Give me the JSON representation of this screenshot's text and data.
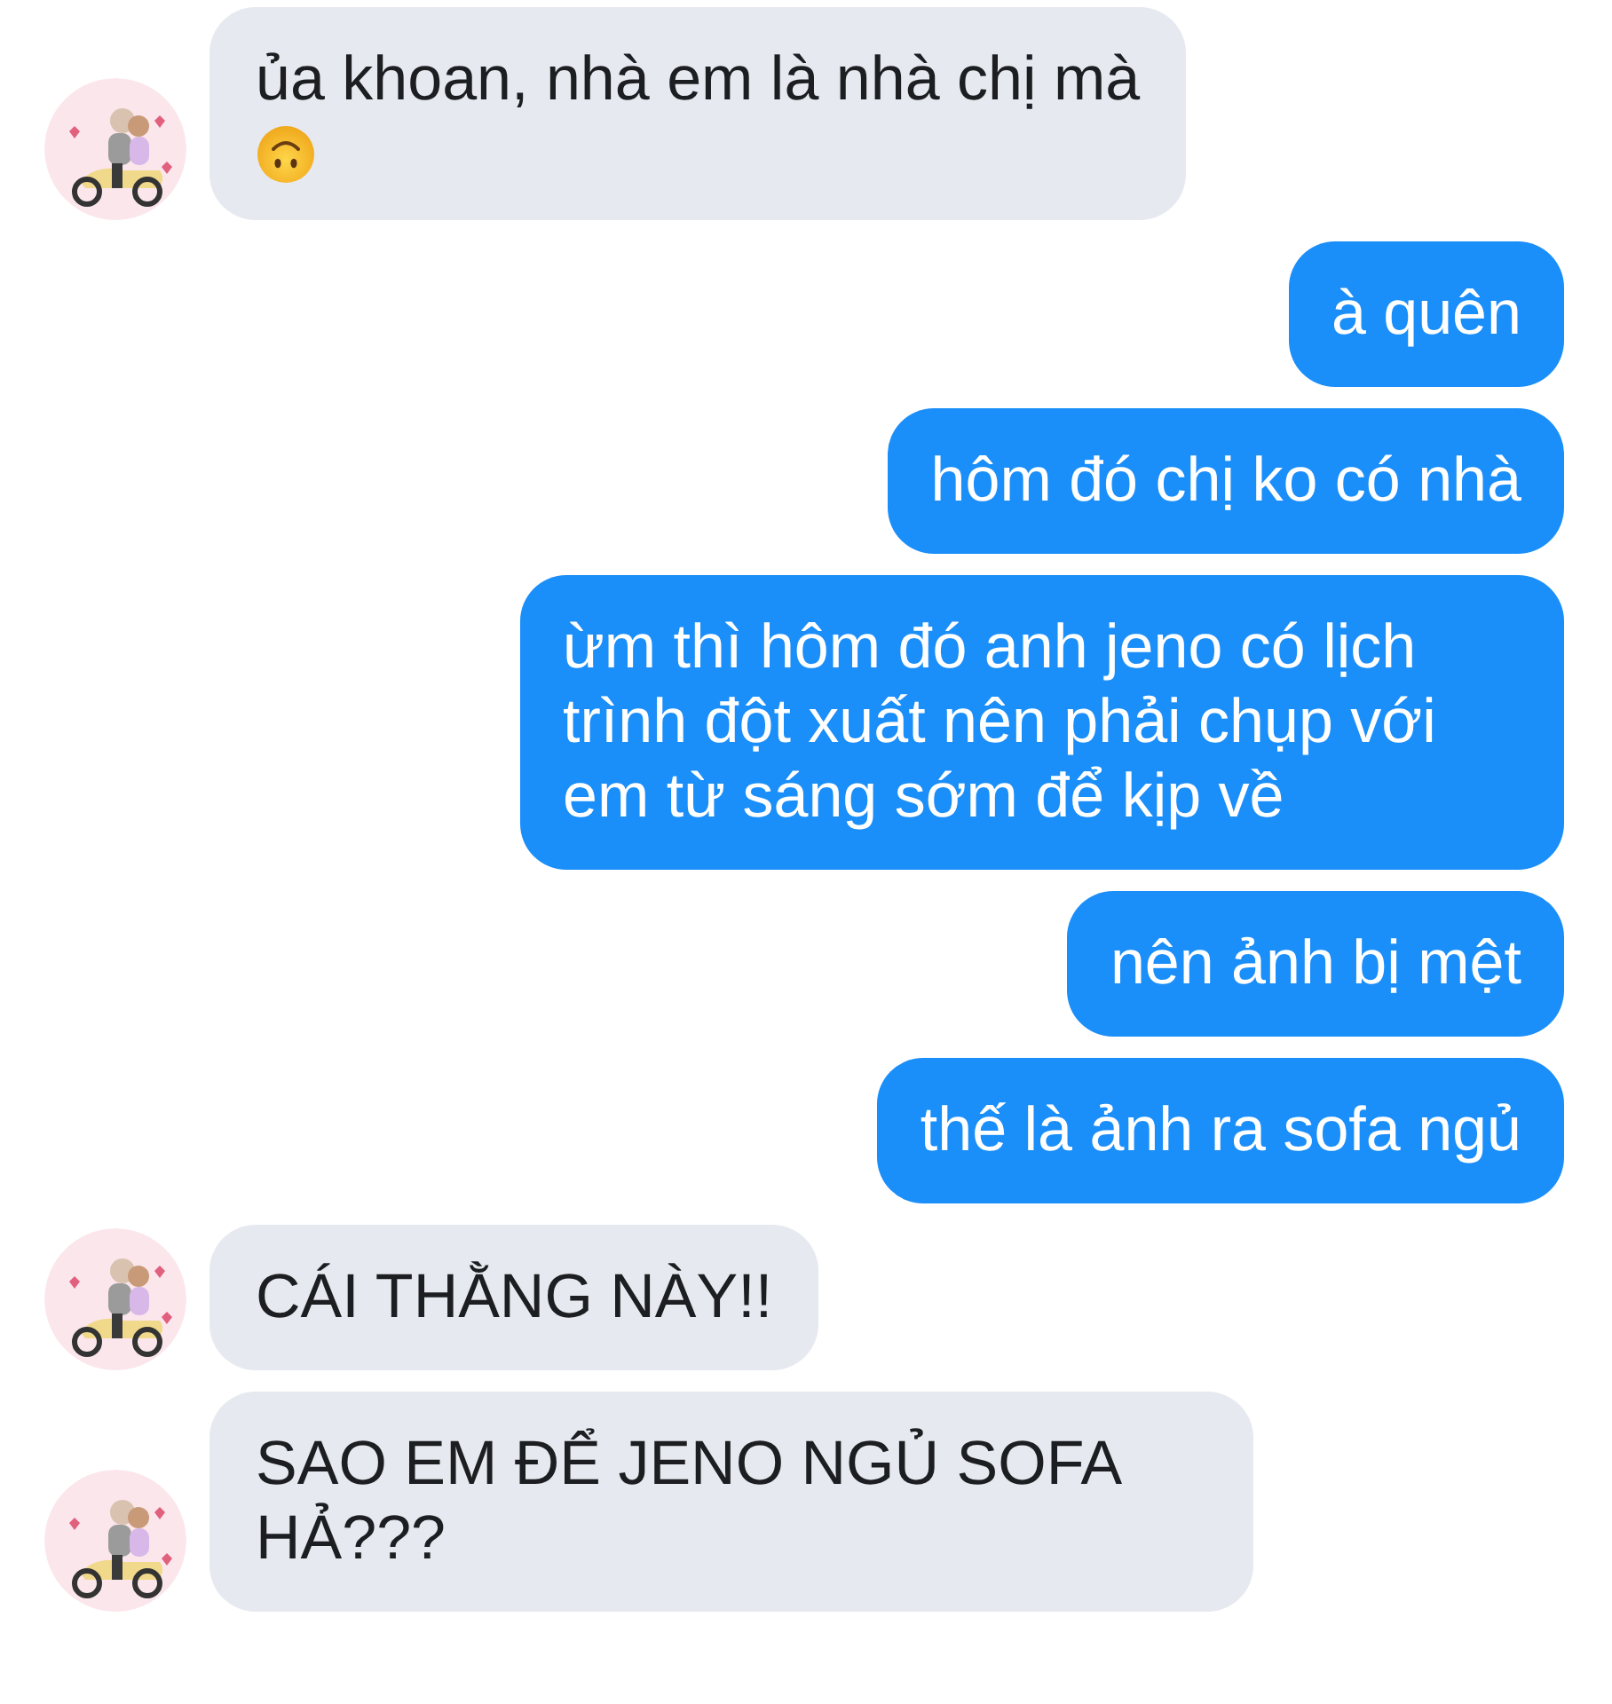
{
  "messages": [
    {
      "kind": "received",
      "text": "ủa khoan, nhà em là nhà chị mà",
      "emoji": true
    },
    {
      "kind": "sent",
      "text": "à quên",
      "emoji": false
    },
    {
      "kind": "sent",
      "text": "hôm đó chị ko có nhà",
      "emoji": false
    },
    {
      "kind": "sent",
      "text": "ừm thì hôm đó anh jeno có lịch trình đột xuất nên phải chụp với em từ sáng sớm để kịp về",
      "emoji": false
    },
    {
      "kind": "sent",
      "text": "nên ảnh bị mệt",
      "emoji": false
    },
    {
      "kind": "sent",
      "text": "thế là ảnh ra sofa ngủ",
      "emoji": false
    },
    {
      "kind": "received",
      "text": "CÁI THẰNG NÀY!!",
      "emoji": false
    },
    {
      "kind": "received",
      "text": "SAO EM ĐỂ JENO NGỦ SOFA HẢ???",
      "emoji": false
    }
  ]
}
